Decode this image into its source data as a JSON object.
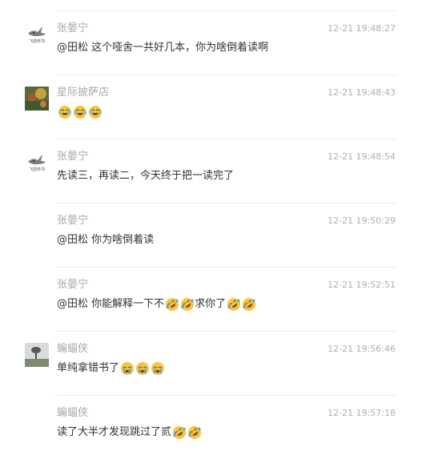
{
  "messages": [
    {
      "name": "张晏宁",
      "time": "12-21 19:48:27",
      "text": "@田松 这个哑舍一共好几本，你为啥倒着读啊",
      "emojis": [],
      "avatar": "pigeon",
      "avatar_caption": "飞鸽传书"
    },
    {
      "name": "星际披萨店",
      "time": "12-21 19:48:43",
      "text": "",
      "emojis": [
        "laugh-cry",
        "laugh-cry",
        "laugh-cry"
      ],
      "avatar": "painting"
    },
    {
      "name": "张晏宁",
      "time": "12-21 19:48:54",
      "text": "先读三，再读二，今天终于把一读完了",
      "emojis": [],
      "avatar": "pigeon",
      "avatar_caption": "飞鸽传书"
    },
    {
      "name": "张晏宁",
      "time": "12-21 19:50:29",
      "text": "@田松 你为啥倒着读",
      "emojis": [],
      "avatar": "none"
    },
    {
      "name": "张晏宁",
      "time": "12-21 19:52:51",
      "text": "@田松 你能解释一下不",
      "emojis": [
        "rofl",
        "rofl"
      ],
      "text2": "求你了",
      "emojis2": [
        "rofl",
        "rofl"
      ],
      "avatar": "none"
    },
    {
      "name": "蝙蝠侠",
      "time": "12-21 19:56:46",
      "text": "单纯拿错书了",
      "emojis": [
        "crying",
        "crying",
        "crying"
      ],
      "avatar": "landscape"
    },
    {
      "name": "蝙蝠侠",
      "time": "12-21 19:57:18",
      "text": "读了大半才发现跳过了贰",
      "emojis": [
        "rofl",
        "rofl"
      ],
      "avatar": "none"
    }
  ],
  "colors": {
    "name": "#a9a9a9",
    "time": "#b0b0b0",
    "text": "#333333",
    "divider": "#ececec"
  }
}
